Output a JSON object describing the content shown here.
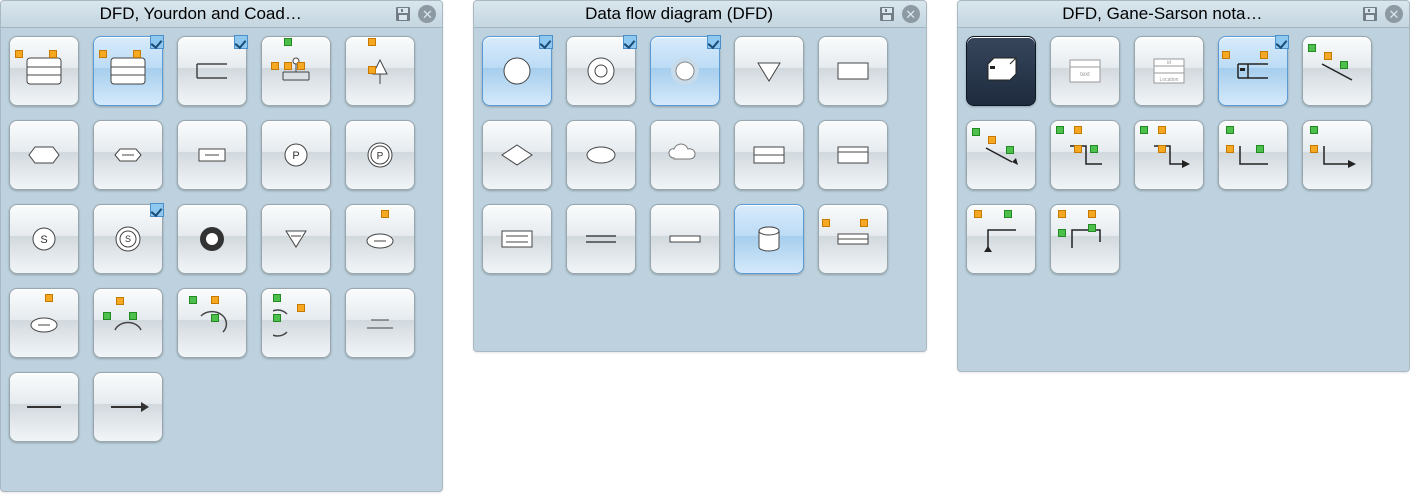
{
  "panels": [
    {
      "title": "DFD, Yourdon and Coad…",
      "shapes": [
        {
          "name": "data-store-1",
          "selected": false,
          "badge": false
        },
        {
          "name": "data-store-2",
          "selected": true,
          "badge": true
        },
        {
          "name": "data-store-open",
          "selected": false,
          "badge": true
        },
        {
          "name": "process-tree",
          "selected": false,
          "badge": false
        },
        {
          "name": "process-triangle",
          "selected": false,
          "badge": false
        },
        {
          "name": "hex-ext-1",
          "selected": false,
          "badge": false
        },
        {
          "name": "hex-ext-2",
          "selected": false,
          "badge": false
        },
        {
          "name": "proc-rect",
          "selected": false,
          "badge": false
        },
        {
          "name": "p-circle",
          "selected": false,
          "badge": false
        },
        {
          "name": "p-circle-bold",
          "selected": false,
          "badge": false
        },
        {
          "name": "s-circle",
          "selected": false,
          "badge": false
        },
        {
          "name": "s-circle-target",
          "selected": false,
          "badge": true
        },
        {
          "name": "ring",
          "selected": false,
          "badge": false
        },
        {
          "name": "down-triangle",
          "selected": false,
          "badge": false
        },
        {
          "name": "ellipse-dot-1",
          "selected": false,
          "badge": false
        },
        {
          "name": "ellipse-dot-2",
          "selected": false,
          "badge": false
        },
        {
          "name": "arc-1",
          "selected": false,
          "badge": false
        },
        {
          "name": "arc-2",
          "selected": false,
          "badge": false
        },
        {
          "name": "arc-3",
          "selected": false,
          "badge": false
        },
        {
          "name": "two-lines",
          "selected": false,
          "badge": false
        },
        {
          "name": "line",
          "selected": false,
          "badge": false
        },
        {
          "name": "arrow",
          "selected": false,
          "badge": false
        }
      ]
    },
    {
      "title": "Data flow diagram (DFD)",
      "shapes": [
        {
          "name": "circle",
          "selected": true,
          "badge": true
        },
        {
          "name": "circle-target",
          "selected": false,
          "badge": true
        },
        {
          "name": "circle-glow",
          "selected": true,
          "badge": true
        },
        {
          "name": "down-tri",
          "selected": false,
          "badge": false
        },
        {
          "name": "rect",
          "selected": false,
          "badge": false
        },
        {
          "name": "diamond",
          "selected": false,
          "badge": false
        },
        {
          "name": "ellipse",
          "selected": false,
          "badge": false
        },
        {
          "name": "cloud",
          "selected": false,
          "badge": false
        },
        {
          "name": "rect-split-h",
          "selected": false,
          "badge": false
        },
        {
          "name": "rect-split-top",
          "selected": false,
          "badge": false
        },
        {
          "name": "rect-bars",
          "selected": false,
          "badge": false
        },
        {
          "name": "double-line",
          "selected": false,
          "badge": false
        },
        {
          "name": "single-bar",
          "selected": false,
          "badge": false
        },
        {
          "name": "cylinder",
          "selected": true,
          "badge": false
        },
        {
          "name": "rect-mid",
          "selected": false,
          "badge": false
        }
      ]
    },
    {
      "title": "DFD, Gane-Sarson nota…",
      "shapes": [
        {
          "name": "store-3d",
          "selected_alt": true,
          "badge": false
        },
        {
          "name": "table-1",
          "selected": false,
          "badge": false
        },
        {
          "name": "table-2",
          "selected": false,
          "badge": false
        },
        {
          "name": "open-rect",
          "selected": true,
          "badge": true
        },
        {
          "name": "conn-diag",
          "selected": false,
          "badge": false
        },
        {
          "name": "conn-diag-arrow",
          "selected": false,
          "badge": false
        },
        {
          "name": "conn-step1",
          "selected": false,
          "badge": false
        },
        {
          "name": "conn-step2",
          "selected": false,
          "badge": false
        },
        {
          "name": "conn-L1",
          "selected": false,
          "badge": false
        },
        {
          "name": "conn-L2",
          "selected": false,
          "badge": false
        },
        {
          "name": "conn-L3",
          "selected": false,
          "badge": false
        },
        {
          "name": "conn-L4",
          "selected": false,
          "badge": false
        }
      ]
    }
  ]
}
